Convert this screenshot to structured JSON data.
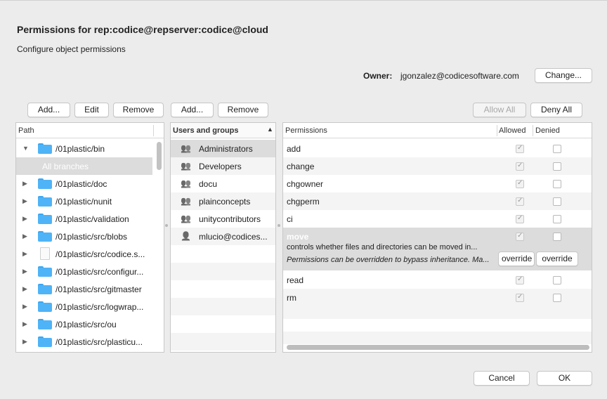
{
  "dialog": {
    "title": "Permissions for rep:codice@repserver:codice@cloud",
    "subtitle": "Configure object permissions"
  },
  "owner": {
    "label": "Owner:",
    "value": "jgonzalez@codicesoftware.com",
    "change_label": "Change..."
  },
  "path_panel": {
    "add_label": "Add...",
    "edit_label": "Edit",
    "remove_label": "Remove",
    "header": "Path",
    "items": [
      {
        "label": "/01plastic/bin",
        "kind": "folder",
        "expanded": true
      },
      {
        "label": "All branches",
        "kind": "child"
      },
      {
        "label": "/01plastic/doc",
        "kind": "folder"
      },
      {
        "label": "/01plastic/nunit",
        "kind": "folder"
      },
      {
        "label": "/01plastic/validation",
        "kind": "folder"
      },
      {
        "label": "/01plastic/src/blobs",
        "kind": "folder"
      },
      {
        "label": "/01plastic/src/codice.s...",
        "kind": "file"
      },
      {
        "label": "/01plastic/src/configur...",
        "kind": "folder"
      },
      {
        "label": "/01plastic/src/gitmaster",
        "kind": "folder"
      },
      {
        "label": "/01plastic/src/logwrap...",
        "kind": "folder"
      },
      {
        "label": "/01plastic/src/ou",
        "kind": "folder"
      },
      {
        "label": "/01plastic/src/plasticu...",
        "kind": "folder"
      }
    ]
  },
  "users_panel": {
    "add_label": "Add...",
    "remove_label": "Remove",
    "header": "Users and groups",
    "items": [
      {
        "label": "Administrators",
        "kind": "group"
      },
      {
        "label": "Developers",
        "kind": "group"
      },
      {
        "label": "docu",
        "kind": "group"
      },
      {
        "label": "plainconcepts",
        "kind": "group"
      },
      {
        "label": "unitycontributors",
        "kind": "group"
      },
      {
        "label": "mlucio@codices...",
        "kind": "user"
      }
    ]
  },
  "perm_panel": {
    "allow_all_label": "Allow All",
    "deny_all_label": "Deny All",
    "header_perm": "Permissions",
    "header_allowed": "Allowed",
    "header_denied": "Denied",
    "rows_top": [
      {
        "name": "add",
        "allowed": true,
        "denied": false
      },
      {
        "name": "change",
        "allowed": true,
        "denied": false
      },
      {
        "name": "chgowner",
        "allowed": true,
        "denied": false
      },
      {
        "name": "chgperm",
        "allowed": true,
        "denied": false
      },
      {
        "name": "ci",
        "allowed": true,
        "denied": false
      }
    ],
    "selected": {
      "name": "move",
      "description": "controls whether files and directories can be moved in...",
      "note": "Permissions can be overridden to bypass inheritance. Ma...",
      "override_allowed_label": "override",
      "override_denied_label": "override"
    },
    "rows_bottom": [
      {
        "name": "read",
        "allowed": true,
        "denied": false
      },
      {
        "name": "rm",
        "allowed": true,
        "denied": false
      }
    ]
  },
  "footer": {
    "cancel_label": "Cancel",
    "ok_label": "OK"
  }
}
